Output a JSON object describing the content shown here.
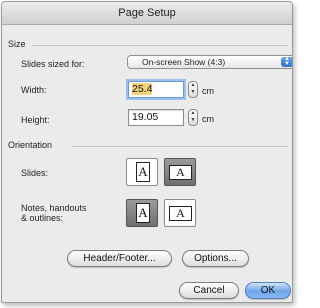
{
  "window": {
    "title": "Page Setup"
  },
  "size": {
    "section_label": "Size",
    "slides_sized_for": {
      "label": "Slides sized for:",
      "value": "On-screen Show (4:3)"
    },
    "width": {
      "label": "Width:",
      "value": "25.4",
      "unit": "cm"
    },
    "height": {
      "label": "Height:",
      "value": "19.05",
      "unit": "cm"
    }
  },
  "orientation": {
    "section_label": "Orientation",
    "slides": {
      "label": "Slides:",
      "portrait_glyph": "A",
      "landscape_glyph": "A",
      "selected": "landscape"
    },
    "notes": {
      "label_line1": "Notes, handouts",
      "label_line2": "& outlines:",
      "portrait_glyph": "A",
      "landscape_glyph": "A",
      "selected": "portrait"
    }
  },
  "buttons": {
    "header_footer": "Header/Footer...",
    "options": "Options...",
    "cancel": "Cancel",
    "ok": "OK"
  },
  "colors": {
    "selection_highlight": "#f4d27a",
    "default_button": "#6fa6ea",
    "selected_orientation": "#7a7a7a"
  }
}
